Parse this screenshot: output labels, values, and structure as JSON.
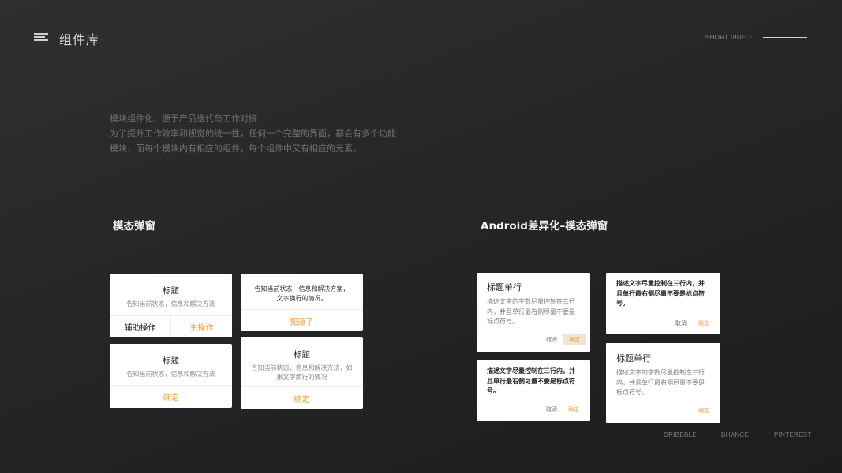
{
  "header": {
    "menu_icon": "menu-icon",
    "title": "组件库",
    "right_label": "SHORT VIDEO"
  },
  "intro": {
    "lines": [
      "模块组件化，便于产品迭代与工作对接",
      "为了提升工作效率和视觉的统一性，任何一个完整的界面，都会有多个功能",
      "模块，而每个模块内有相应的组件，每个组件中又有相应的元素。"
    ]
  },
  "sections": {
    "ios_title": "模态弹窗",
    "android_title": "Android差异化–模态弹窗"
  },
  "ios_dialogs": {
    "d1": {
      "title": "标题",
      "desc": "告知当前状态，信息和解决方法",
      "secondary": "辅助操作",
      "primary": "主操作"
    },
    "d2": {
      "desc_line1": "告知当前状态，信息和解决方案，",
      "desc_line2": "文字换行的情况。",
      "button": "知道了"
    },
    "d3": {
      "title": "标题",
      "desc": "告知当前状态，信息和解决方法",
      "button": "确定"
    },
    "d4": {
      "title": "标题",
      "desc_line1": "告知当前状态，信息和解决方法，如",
      "desc_line2": "果文字换行的情况",
      "button": "确定"
    }
  },
  "android_dialogs": {
    "a1": {
      "title": "标题单行",
      "desc_lines": [
        "描述文字的字数尽量控制在三行",
        "内，并且单行最右侧尽量不要是",
        "标点符号。"
      ],
      "cancel": "取消",
      "confirm": "确定"
    },
    "a2": {
      "desc_lines": [
        "描述文字尽量控制在三行内，并",
        "且单行最右侧尽量不要是标点符",
        "号。"
      ],
      "cancel": "取消",
      "confirm": "确定"
    },
    "a3": {
      "desc_lines": [
        "描述文字尽量控制在三行内，并",
        "且单行最右侧尽量不要是标点符",
        "号。"
      ],
      "cancel": "取消",
      "confirm": "确定"
    },
    "a4": {
      "title": "标题单行",
      "desc_lines": [
        "描述文字的字数尽量控制在三行",
        "内，并且单行最右侧尽量不要是",
        "标点符号。"
      ],
      "confirm": "确定"
    }
  },
  "footer": {
    "links": [
      "DRIBBBLE",
      "BHANCE",
      "PINTEREST"
    ]
  },
  "colors": {
    "accent": "#f0a43a",
    "background": "#262628",
    "card": "#ffffff"
  }
}
